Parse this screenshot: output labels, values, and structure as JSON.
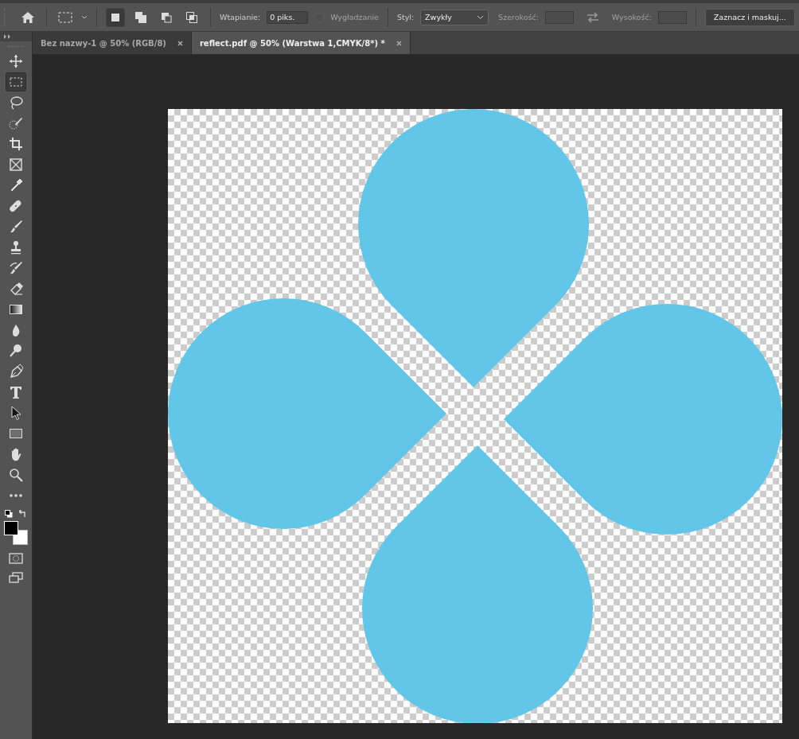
{
  "options_bar": {
    "selection_modes": [
      {
        "selected": true
      },
      {
        "selected": false
      },
      {
        "selected": false
      },
      {
        "selected": false
      }
    ],
    "feather": {
      "label": "Wtapianie:",
      "value": "0 piks."
    },
    "antialias": {
      "label": "Wygładzanie",
      "checked": false
    },
    "style": {
      "label": "Styl:",
      "value": "Zwykły"
    },
    "width": {
      "label": "Szerokość:"
    },
    "height": {
      "label": "Wysokość:"
    },
    "mask_button": "Zaznacz i maskuj..."
  },
  "tabs": [
    {
      "label": "Bez nazwy-1 @ 50% (RGB/8)",
      "selected": false
    },
    {
      "label": "reflect.pdf @ 50% (Warstwa 1,CMYK/8*) *",
      "selected": true
    }
  ],
  "tools": [
    {
      "kind": "move",
      "selected": false
    },
    {
      "kind": "marquee",
      "selected": true
    },
    {
      "kind": "lasso",
      "selected": false
    },
    {
      "kind": "quickselect",
      "selected": false
    },
    {
      "kind": "crop",
      "selected": false
    },
    {
      "kind": "frame",
      "selected": false
    },
    {
      "kind": "eyedropper",
      "selected": false
    },
    {
      "kind": "heal",
      "selected": false
    },
    {
      "kind": "brush",
      "selected": false
    },
    {
      "kind": "stamp",
      "selected": false
    },
    {
      "kind": "history",
      "selected": false
    },
    {
      "kind": "eraser",
      "selected": false
    },
    {
      "kind": "gradient",
      "selected": false
    },
    {
      "kind": "blur",
      "selected": false
    },
    {
      "kind": "dodge",
      "selected": false
    },
    {
      "kind": "pen",
      "selected": false
    },
    {
      "kind": "type",
      "selected": false
    },
    {
      "kind": "pathselect",
      "selected": false
    },
    {
      "kind": "rectangle",
      "selected": false
    },
    {
      "kind": "hand",
      "selected": false
    },
    {
      "kind": "zoom",
      "selected": false
    },
    {
      "kind": "more",
      "selected": false
    }
  ]
}
